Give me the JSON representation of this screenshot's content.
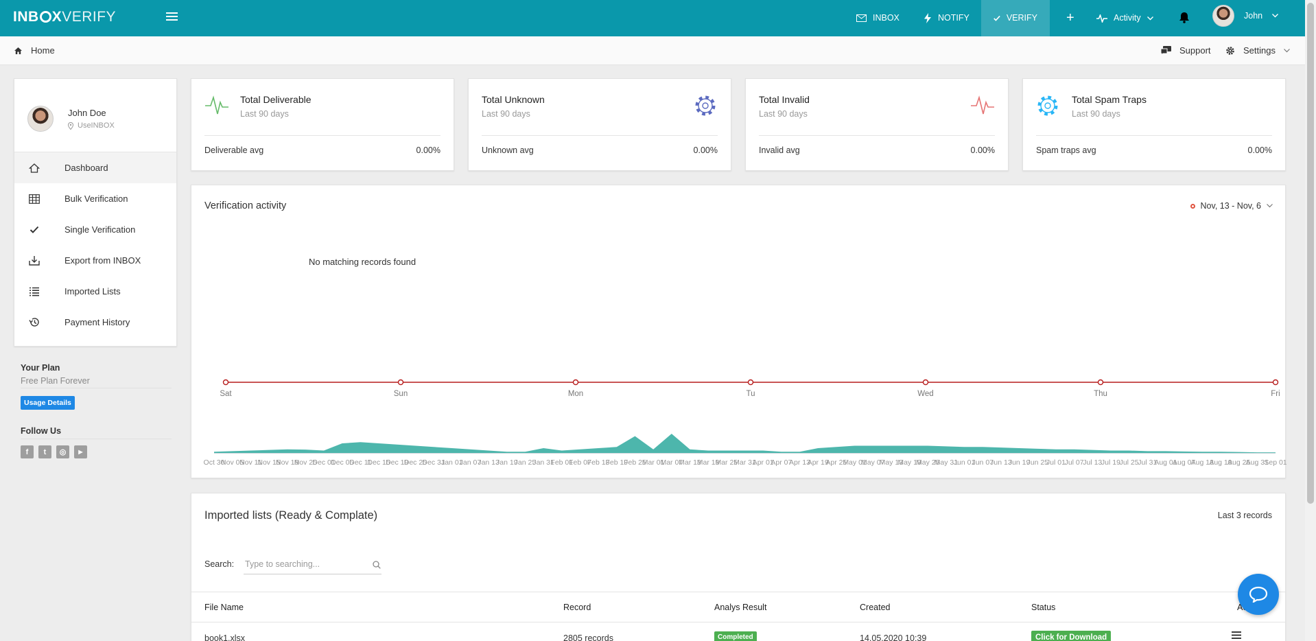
{
  "brand": {
    "part1": "INB",
    "part2": "X",
    "part3": "VERIFY"
  },
  "nav": {
    "inbox": "INBOX",
    "notify": "NOTIFY",
    "verify": "VERIFY",
    "activity": "Activity",
    "user": "John"
  },
  "breadcrumb": {
    "home": "Home",
    "support": "Support",
    "settings": "Settings"
  },
  "profile": {
    "name": "John Doe",
    "location": "UseINBOX"
  },
  "sidebar": {
    "items": [
      {
        "label": "Dashboard",
        "icon": "home-icon"
      },
      {
        "label": "Bulk Verification",
        "icon": "table-icon"
      },
      {
        "label": "Single Verification",
        "icon": "check-icon"
      },
      {
        "label": "Export from INBOX",
        "icon": "export-icon"
      },
      {
        "label": "Imported Lists",
        "icon": "list-icon"
      },
      {
        "label": "Payment History",
        "icon": "history-icon"
      }
    ]
  },
  "plan": {
    "title": "Your Plan",
    "name": "Free Plan Forever",
    "button": "Usage Details"
  },
  "follow": {
    "title": "Follow Us",
    "networks": [
      "facebook-icon",
      "twitter-icon",
      "instagram-icon",
      "youtube-icon"
    ]
  },
  "stats": [
    {
      "title": "Total Deliverable",
      "sub": "Last 90 days",
      "foot_label": "Deliverable avg",
      "foot_value": "0.00%",
      "icon": "pulse-icon",
      "color": "#66bb6a"
    },
    {
      "title": "Total Unknown",
      "sub": "Last 90 days",
      "foot_label": "Unknown avg",
      "foot_value": "0.00%",
      "icon": "gear-icon",
      "color": "#5c6bc0"
    },
    {
      "title": "Total Invalid",
      "sub": "Last 90 days",
      "foot_label": "Invalid avg",
      "foot_value": "0.00%",
      "icon": "pulse-icon",
      "color": "#e57373"
    },
    {
      "title": "Total Spam Traps",
      "sub": "Last 90 days",
      "foot_label": "Spam traps avg",
      "foot_value": "0.00%",
      "icon": "gear-icon",
      "color": "#29b6f6"
    }
  ],
  "activity": {
    "title": "Verification activity",
    "range": "Nov, 13 - Nov, 6",
    "empty": "No matching records found"
  },
  "chart_data": [
    {
      "type": "line",
      "categories": [
        "Sat",
        "Sun",
        "Mon",
        "Tu",
        "Wed",
        "Thu",
        "Fri"
      ],
      "series": [
        {
          "values": [
            0,
            0,
            0,
            0,
            0,
            0,
            0
          ]
        }
      ],
      "colors": {
        "line": "#b71c1c"
      }
    },
    {
      "type": "area",
      "x": [
        "Oct 30",
        "Nov 05",
        "Nov 11",
        "Nov 15",
        "Nov 19",
        "Nov 25",
        "Dec 01",
        "Dec 05",
        "Dec 11",
        "Dec 15",
        "Dec 19",
        "Dec 25",
        "Dec 31",
        "Jan 01",
        "Jan 07",
        "Jan 13",
        "Jan 19",
        "Jan 25",
        "Jan 31",
        "Feb 01",
        "Feb 07",
        "Feb 13",
        "Feb 19",
        "Feb 25",
        "Mar 01",
        "Mar 07",
        "Mar 13",
        "Mar 19",
        "Mar 25",
        "Mar 31",
        "Apr 01",
        "Apr 07",
        "Apr 13",
        "Apr 19",
        "Apr 25",
        "May 01",
        "May 07",
        "May 13",
        "May 19",
        "May 25",
        "May 31",
        "Jun 01",
        "Jun 07",
        "Jun 13",
        "Jun 19",
        "Jun 25",
        "Jul 01",
        "Jul 07",
        "Jul 13",
        "Jul 19",
        "Jul 25",
        "Jul 31",
        "Aug 01",
        "Aug 07",
        "Aug 13",
        "Aug 19",
        "Aug 25",
        "Aug 31",
        "Sep 01"
      ],
      "series": [
        {
          "values": [
            1,
            1.5,
            2,
            2.5,
            3,
            2.8,
            2,
            8,
            9,
            8,
            7,
            6,
            5,
            4,
            3,
            2,
            1,
            1,
            4,
            2,
            3,
            4,
            5,
            14,
            3,
            16,
            3,
            2,
            2,
            2,
            2,
            1,
            1,
            4,
            5,
            6,
            6,
            6,
            6,
            6,
            5.5,
            5,
            5,
            4.5,
            4,
            3.5,
            3,
            3,
            2.5,
            2,
            2,
            1.5,
            1.5,
            1.2,
            1,
            1,
            0.8,
            0.5,
            0.5
          ]
        }
      ],
      "colors": {
        "fill": "#4db6ac"
      }
    }
  ],
  "imported": {
    "title": "Imported lists (Ready & Complate)",
    "right": "Last 3 records",
    "search_label": "Search:",
    "search_placeholder": "Type to searching...",
    "columns": [
      "File Name",
      "Record",
      "Analys Result",
      "Created",
      "Status",
      "Ac"
    ],
    "rows": [
      {
        "file": "book1.xlsx",
        "record": "2805 records",
        "result": "Completed",
        "created": "14.05.2020 10:39",
        "status": "Click for Download"
      }
    ]
  }
}
